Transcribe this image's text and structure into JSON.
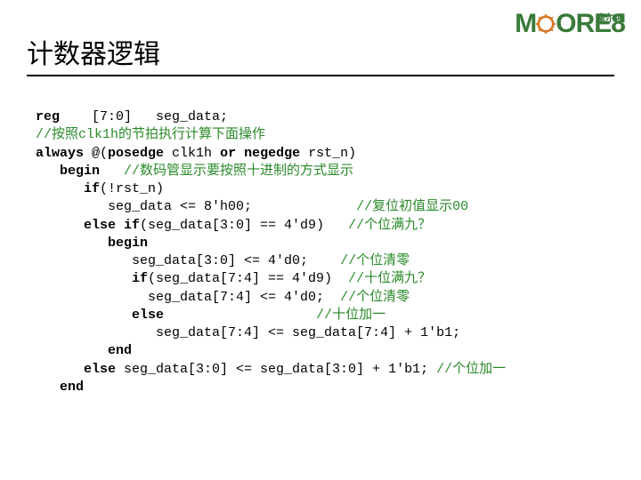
{
  "logo": {
    "m": "M",
    "ore8": "ORE8",
    "cn": "摩尔吧"
  },
  "title": "计数器逻辑",
  "code": {
    "l1_a": "reg",
    "l1_b": "    [7:0]   seg_data;",
    "l2": "//按照clk1h的节拍执行计算下面操作",
    "l3_a": "always",
    "l3_b": " @(",
    "l3_c": "posedge",
    "l3_d": " clk1h ",
    "l3_e": "or negedge",
    "l3_f": " rst_n)",
    "l4_a": "   begin",
    "l4_b": "   //数码管显示要按照十进制的方式显示",
    "l5_a": "      if",
    "l5_b": "(!rst_n)",
    "l6_a": "         seg_data <= 8'h00;             ",
    "l6_b": "//复位初值显示00",
    "l7_a": "      else if",
    "l7_b": "(seg_data[3:0] == 4'd9)   ",
    "l7_c": "//个位满九？",
    "l8": "         begin",
    "l9_a": "            seg_data[3:0] <= 4'd0;    ",
    "l9_b": "//个位清零",
    "l10_a": "            if",
    "l10_b": "(seg_data[7:4] == 4'd9)  ",
    "l10_c": "//十位满九？",
    "l11_a": "              seg_data[7:4] <= 4'd0;  ",
    "l11_b": "//个位清零",
    "l12_a": "            else",
    "l12_b": "                   ",
    "l12_c": "//十位加一",
    "l13": "               seg_data[7:4] <= seg_data[7:4] + 1'b1;",
    "l14": "         end",
    "l15_a": "      else",
    "l15_b": " seg_data[3:0] <= seg_data[3:0] + 1'b1; ",
    "l15_c": "//个位加一",
    "l16": "   end"
  }
}
